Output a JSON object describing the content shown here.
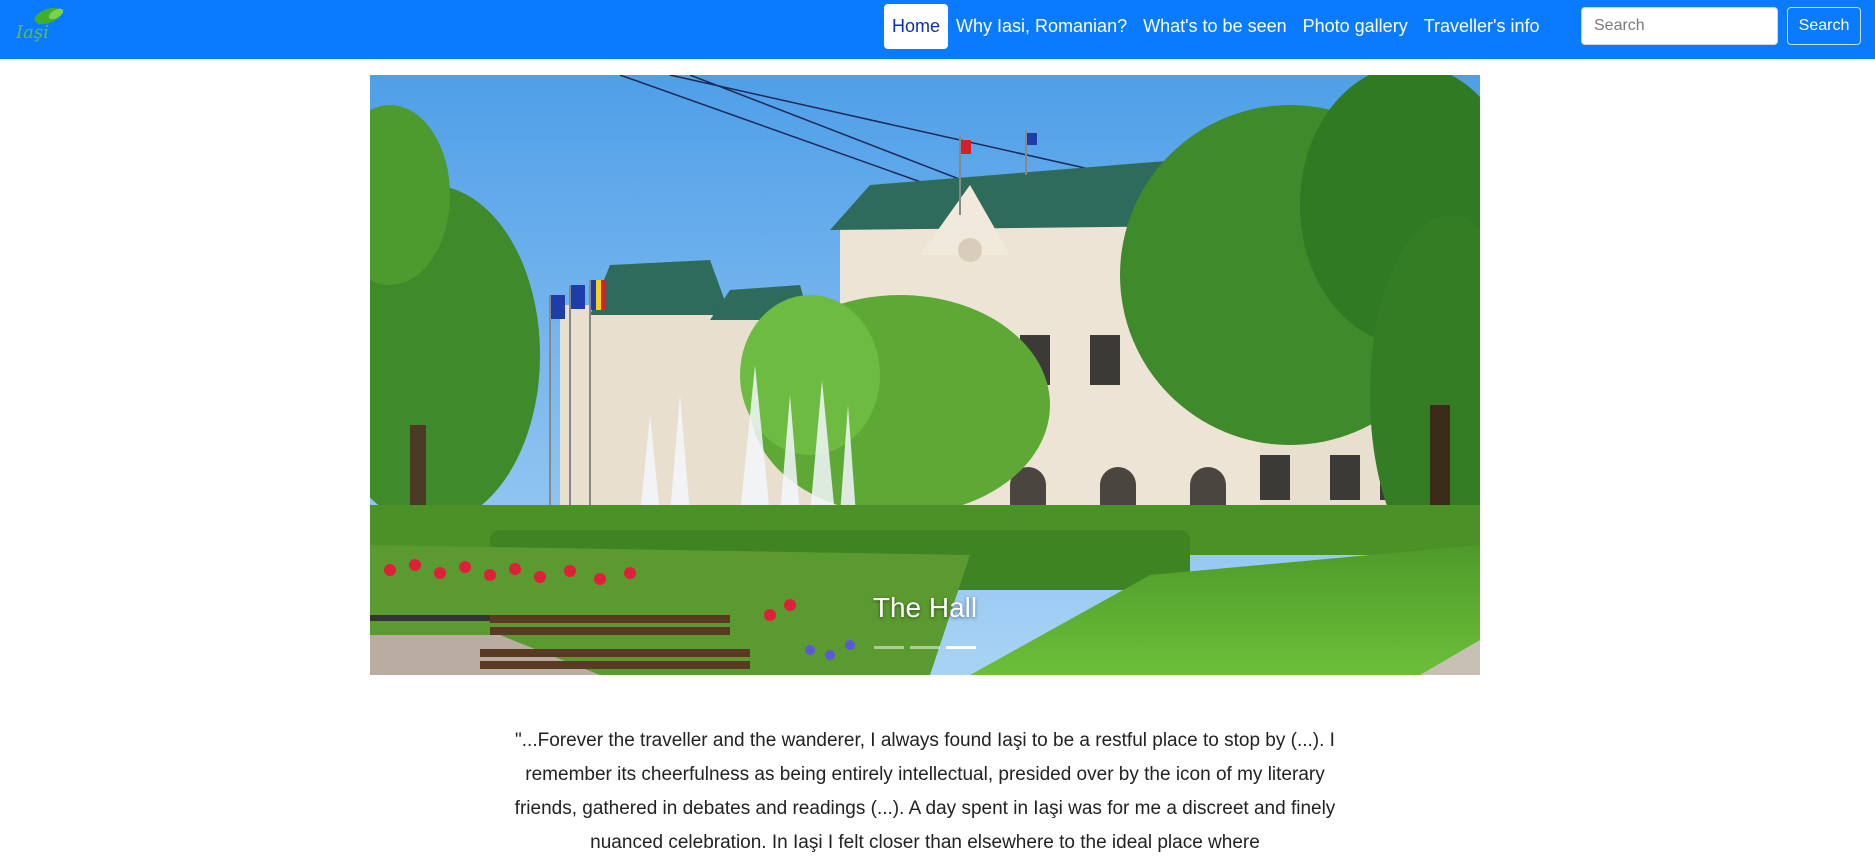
{
  "nav": {
    "logo_text": "Iaşi",
    "links": [
      {
        "label": "Home",
        "active": true
      },
      {
        "label": "Why Iasi, Romanian?",
        "active": false
      },
      {
        "label": "What's to be seen",
        "active": false
      },
      {
        "label": "Photo gallery",
        "active": false
      },
      {
        "label": "Traveller's info",
        "active": false
      }
    ],
    "search_placeholder": "Search",
    "search_button": "Search"
  },
  "carousel": {
    "caption": "The Hall",
    "slide_count": 3,
    "active_slide": 2
  },
  "quote": {
    "text": "\"...Forever the traveller and the wanderer, I always found Iaşi to be a restful place to stop by (...). I remember its cheerfulness as being entirely intellectual, presided over by the icon of my literary friends, gathered in debates and readings (...). A day spent in Iaşi was for me a discreet and finely nuanced celebration. In Iaşi I felt closer than elsewhere to the ideal place where"
  },
  "colors": {
    "navbar": "#0a7bff",
    "active_link_text": "#0a2fb0"
  }
}
